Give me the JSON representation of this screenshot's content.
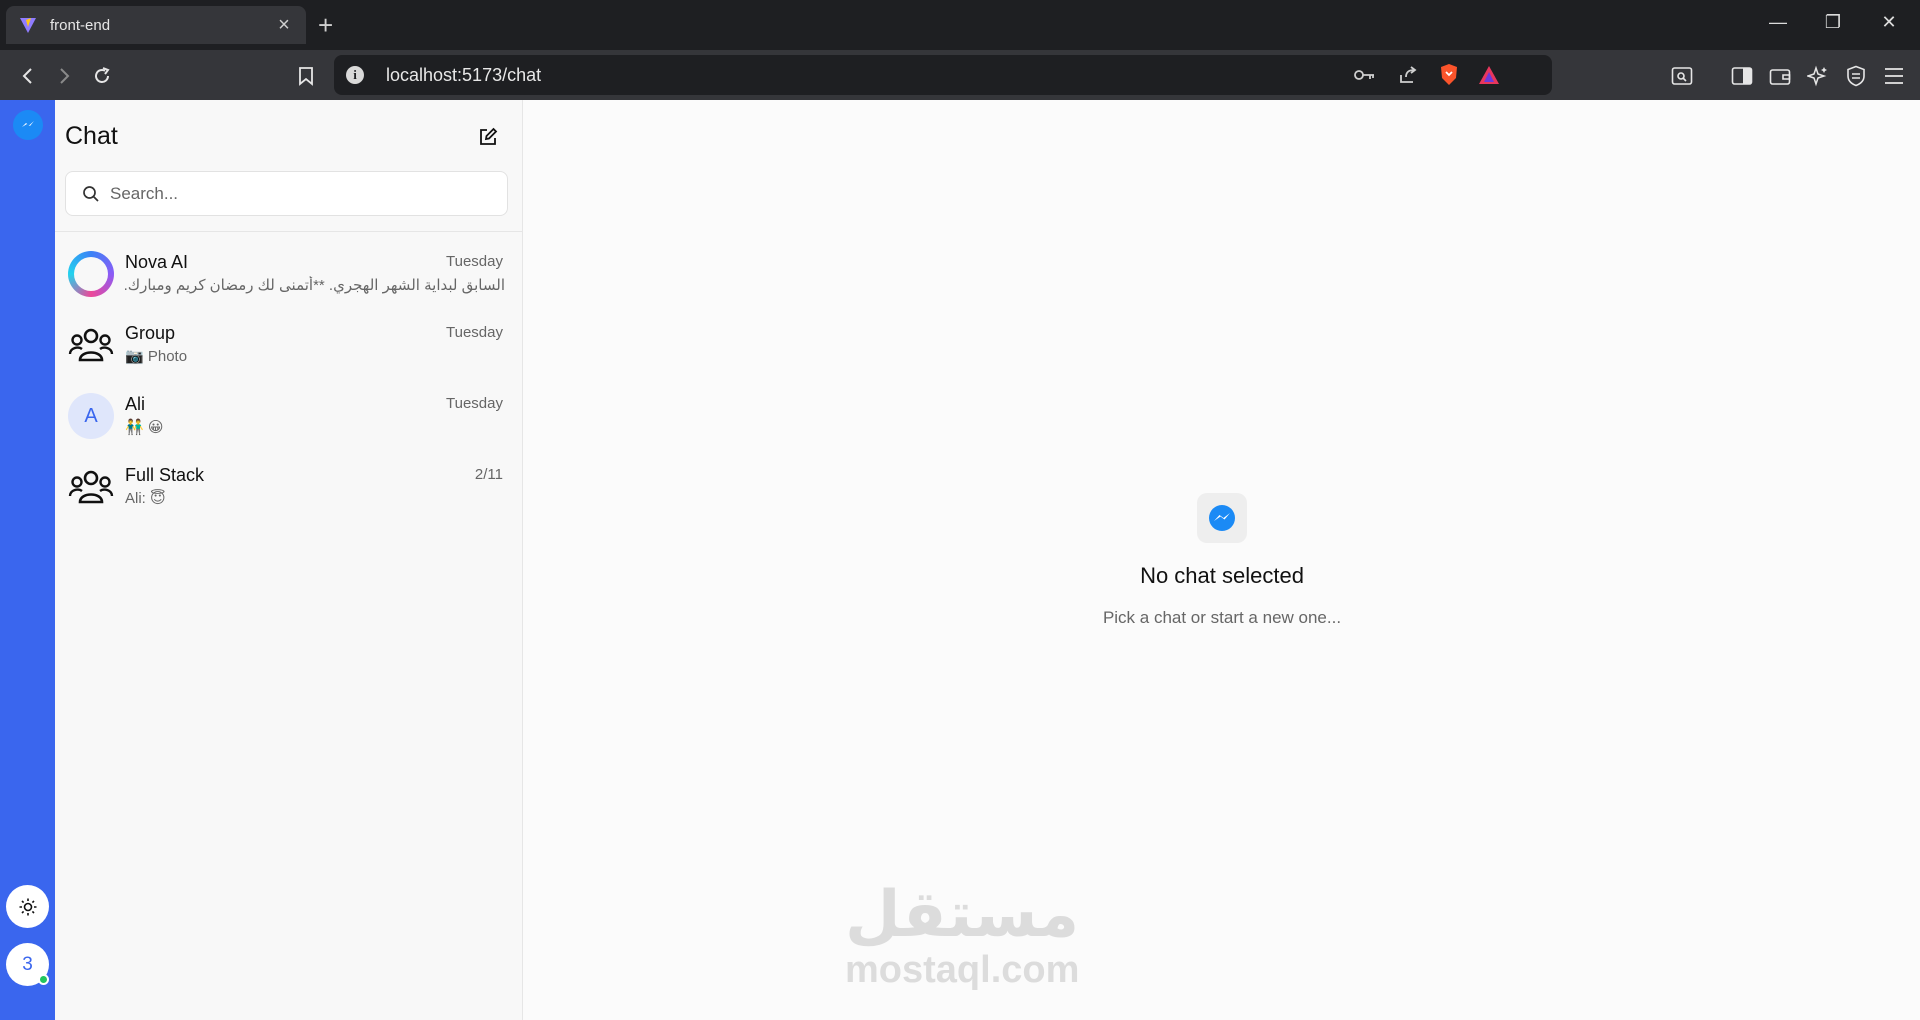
{
  "browser": {
    "tab_title": "front-end",
    "url": "localhost:5173/chat"
  },
  "sidebar": {
    "title": "Chat",
    "search_placeholder": "Search..."
  },
  "chats": [
    {
      "name": "Nova AI",
      "time": "Tuesday",
      "preview": "السابق لبداية الشهر الهجري. **أتمنى لك رمضان كريم ومبارك..."
    },
    {
      "name": "Group",
      "time": "Tuesday",
      "preview": "📷 Photo"
    },
    {
      "name": "Ali",
      "avatar_letter": "A",
      "time": "Tuesday",
      "preview": "👬 😀"
    },
    {
      "name": "Full Stack",
      "time": "2/11",
      "preview": "Ali: 😇"
    }
  ],
  "rail": {
    "user_initial": "3"
  },
  "empty_state": {
    "title": "No chat selected",
    "subtitle": "Pick a chat or start a new one..."
  },
  "watermark": {
    "arabic": "مستقل",
    "latin": "mostaql.com"
  },
  "colors": {
    "rail": "#3a66ee",
    "messenger_blue": "#1b8af5",
    "online": "#22c55e"
  }
}
